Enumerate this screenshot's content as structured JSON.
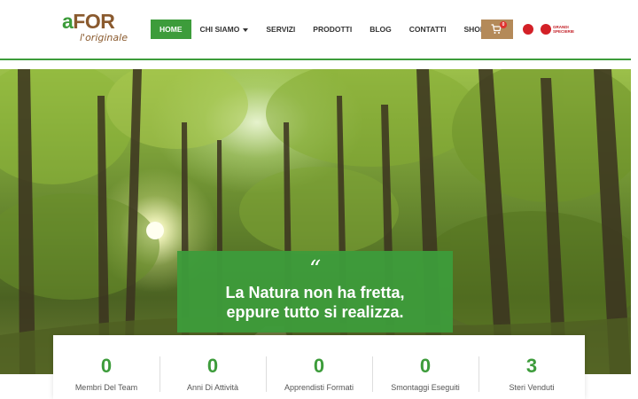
{
  "logo": {
    "brand_a": "a",
    "brand_rest": "FOR",
    "tagline": "l'originale"
  },
  "nav": {
    "items": [
      {
        "label": "HOME",
        "active": true
      },
      {
        "label": "CHI SIAMO",
        "dropdown": true
      },
      {
        "label": "SERVIZI"
      },
      {
        "label": "PRODOTTI"
      },
      {
        "label": "BLOG"
      },
      {
        "label": "CONTATTI"
      },
      {
        "label": "SHOP"
      }
    ]
  },
  "cart": {
    "count": "0",
    "icon": "cart-icon"
  },
  "partners": {
    "logo2_text": "GRANDI SPECIERIE"
  },
  "hero": {
    "quote_mark": "“",
    "quote_line1": "La Natura non ha fretta,",
    "quote_line2": "eppure tutto si realizza."
  },
  "stats": [
    {
      "value": "0",
      "label": "Membri Del Team"
    },
    {
      "value": "0",
      "label": "Anni Di Attività"
    },
    {
      "value": "0",
      "label": "Apprendisti Formati"
    },
    {
      "value": "0",
      "label": "Smontaggi Eseguiti"
    },
    {
      "value": "3",
      "label": "Steri Venduti"
    }
  ],
  "colors": {
    "accent": "#3d9c3b",
    "brand_brown": "#8a5a2e",
    "cart_bg": "#b48a59"
  }
}
